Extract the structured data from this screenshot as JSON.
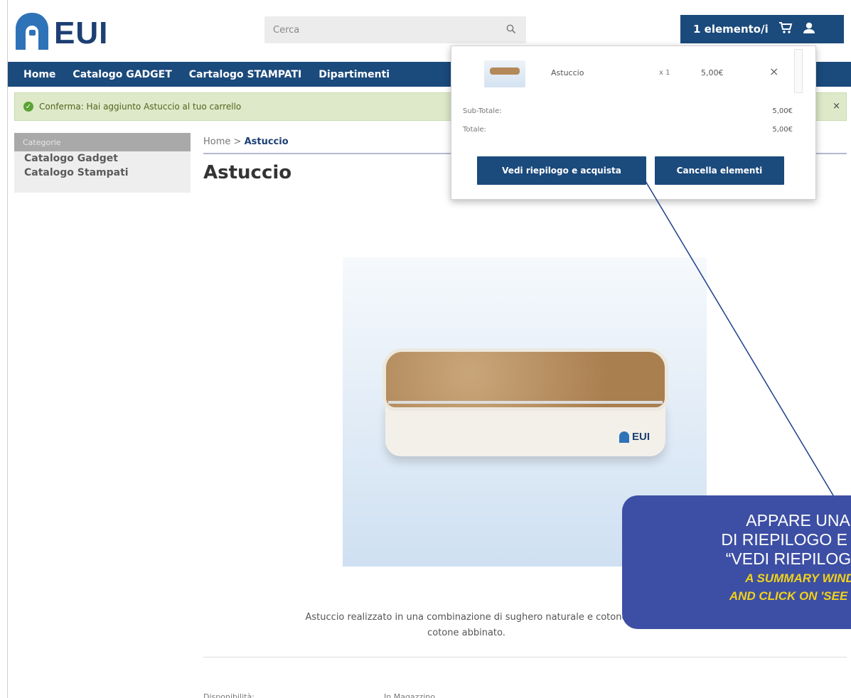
{
  "header": {
    "logo_text": "EUI",
    "search_placeholder": "Cerca",
    "cart_label": "1 elemento/i"
  },
  "nav": {
    "items": [
      "Home",
      "Catalogo GADGET",
      "Cartalogo STAMPATI",
      "Dipartimenti"
    ]
  },
  "confirm": {
    "message": "Conferma: Hai aggiunto Astuccio al tuo carrello",
    "close": "×"
  },
  "sidebar": {
    "heading": "Categorie",
    "items": [
      "Catalogo Gadget",
      "Catalogo Stampati"
    ]
  },
  "breadcrumb": {
    "home": "Home",
    "separator": ">",
    "current": "Astuccio"
  },
  "product": {
    "title": "Astuccio",
    "image_logo_text": "EUI",
    "description_line1": "Astuccio realizzato in una combinazione di sughero naturale e cotone",
    "description_line2": "cotone abbinato.",
    "availability_label": "Disponibilità:",
    "availability_value": "In Magazzino"
  },
  "cart_popup": {
    "item_name": "Astuccio",
    "item_qty": "x 1",
    "item_price": "5,00€",
    "remove": "×",
    "subtotal_label": "Sub-Totale:",
    "subtotal_value": "5,00€",
    "total_label": "Totale:",
    "total_value": "5,00€",
    "checkout_button": "Vedi riepilogo e acquista",
    "clear_button": "Cancella elementi"
  },
  "callout": {
    "line1": "APPARE UNA F",
    "line2": "DI RIEPILOGO E C",
    "line3": "“VEDI RIEPILOGO",
    "line4": "A SUMMARY WINDO",
    "line5": "AND CLICK ON 'SEE OI"
  },
  "colors": {
    "primary_navy": "#1b4a7c",
    "logo_blue": "#2e73b8",
    "confirm_bg": "#dde9c8",
    "callout_bg": "#3d4fa4",
    "callout_yellow": "#f2d21a"
  }
}
